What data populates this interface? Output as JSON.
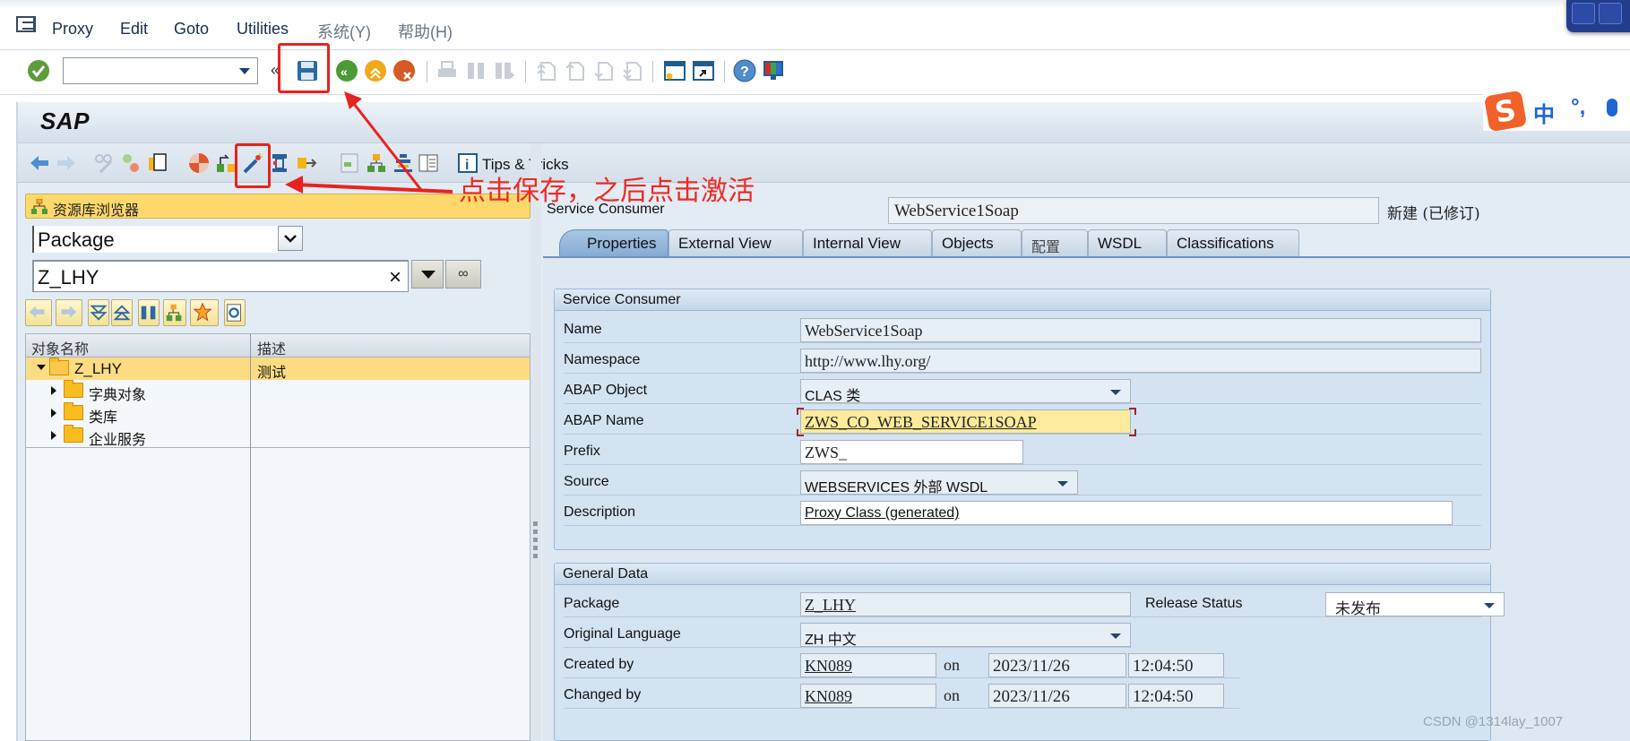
{
  "menubar": {
    "items": [
      {
        "label": "Proxy",
        "dim": false
      },
      {
        "label": "Edit",
        "dim": false
      },
      {
        "label": "Goto",
        "dim": false
      },
      {
        "label": "Utilities",
        "dim": false
      },
      {
        "label": "系统(Y)",
        "dim": true
      },
      {
        "label": "帮助(H)",
        "dim": true
      }
    ]
  },
  "toolbar1": {
    "command_field_value": "",
    "icons": [
      "enter-icon",
      "save-icon",
      "back-icon",
      "exit-icon",
      "cancel-icon",
      "print-icon",
      "find-icon",
      "find-next-icon",
      "first-page-icon",
      "previous-page-icon",
      "next-page-icon",
      "last-page-icon",
      "new-session-icon",
      "shortcut-icon",
      "help-icon",
      "customize-layout-icon"
    ]
  },
  "sap_title": "SAP",
  "toolbar2": {
    "icons": [
      "back-arrow-icon",
      "forward-arrow-icon",
      "display-change-icon",
      "other-object-icon",
      "copy-object-icon",
      "check-icon",
      "where-used-icon",
      "activate-icon",
      "test-icon",
      "navigate-icon",
      "object-list-icon",
      "hierarchy-icon",
      "stack-icon",
      "info-list-icon",
      "tips-info-icon"
    ],
    "tips_label": "Tips & Tricks"
  },
  "ime": {
    "logo": "S",
    "mode": "中",
    "punct": "°,"
  },
  "navigator": {
    "header": "资源库浏览器",
    "type_select": "Package",
    "object_input": "Z_LHY",
    "clear_symbol": "×",
    "columns": [
      "对象名称",
      "描述"
    ],
    "tree": [
      {
        "label": "Z_LHY",
        "desc": "测试",
        "level": 0,
        "expanded": true,
        "selected": true
      },
      {
        "label": "字典对象",
        "desc": "",
        "level": 1,
        "expanded": false,
        "selected": false
      },
      {
        "label": "类库",
        "desc": "",
        "level": 1,
        "expanded": false,
        "selected": false
      },
      {
        "label": "企业服务",
        "desc": "",
        "level": 1,
        "expanded": false,
        "selected": false
      }
    ]
  },
  "consumer": {
    "label": "Service Consumer",
    "name": "WebService1Soap",
    "status": "新建 (已修订)",
    "tabs": [
      {
        "label": "Properties",
        "active": true
      },
      {
        "label": "External View",
        "active": false
      },
      {
        "label": "Internal View",
        "active": false
      },
      {
        "label": "Objects",
        "active": false
      },
      {
        "label": "配置",
        "active": false
      },
      {
        "label": "WSDL",
        "active": false
      },
      {
        "label": "Classifications",
        "active": false
      }
    ],
    "group1": {
      "title": "Service Consumer",
      "fields": {
        "name": {
          "label": "Name",
          "value": "WebService1Soap"
        },
        "namespace": {
          "label": "Namespace",
          "value": "http://www.lhy.org/"
        },
        "abap_object": {
          "label": "ABAP Object",
          "value": "CLAS 类"
        },
        "abap_name": {
          "label": "ABAP Name",
          "value": "ZWS_CO_WEB_SERVICE1SOAP"
        },
        "prefix": {
          "label": "Prefix",
          "value": "ZWS_"
        },
        "source": {
          "label": "Source",
          "value": "WEBSERVICES 外部 WSDL"
        },
        "description": {
          "label": "Description",
          "value": "Proxy Class (generated)"
        }
      }
    },
    "group2": {
      "title": "General Data",
      "package": {
        "label": "Package",
        "value": "Z_LHY"
      },
      "release_status": {
        "label": "Release Status",
        "value": "未发布"
      },
      "language": {
        "label": "Original Language",
        "value": "ZH 中文"
      },
      "created": {
        "label": "Created by",
        "user": "KN089",
        "on": "on",
        "date": "2023/11/26",
        "time": "12:04:50"
      },
      "changed": {
        "label": "Changed by",
        "user": "KN089",
        "on": "on",
        "date": "2023/11/26",
        "time": "12:04:50"
      }
    }
  },
  "annotation": {
    "text": "点击保存，之后点击激活",
    "color": "#ee2a24"
  },
  "watermark": "CSDN @1314lay_1007"
}
